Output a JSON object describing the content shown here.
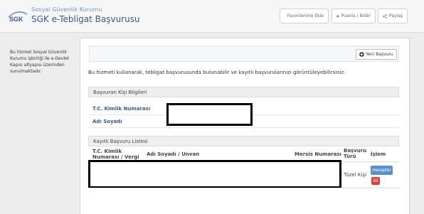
{
  "header": {
    "institution": "Sosyal Güvenlik Kurumu",
    "app_title": "SGK e-Tebligat Başvurusu",
    "logo_text": "SGK",
    "buttons": {
      "favorites": "Favorilerime Ekle",
      "rate": "Puanla / Bildir",
      "share": "Paylaş"
    }
  },
  "sidebar": {
    "note": "Bu hizmet Sosyal Güvenlik Kurumu işbirliği ile e-Devlet Kapısı altyapısı üzerinden sunulmaktadır."
  },
  "main": {
    "new_application": "Yeni Başvuru",
    "intro": "Bu hizmeti kullanarak, tebligat başvurusunda bulunabilir ve kayıtlı başvurularınızı görüntüleyebilirsiniz.",
    "applicant": {
      "title": "Başvuran Kişi Bilgileri",
      "tc_label": "T.C. Kimlik Numarası",
      "name_label": "Adı Soyadı"
    },
    "list": {
      "title": "Kayıtlı Başvuru Listesi",
      "headers": {
        "tc": "T.C. Kimlik Numarası / Vergi Numarası",
        "name": "Adı Soyadı / Unvan",
        "mersis": "Mersis Numarası",
        "type": "Başvuru Türü",
        "action": "İşlem"
      },
      "rows": [
        {
          "type": "Tüzel Kişi",
          "detail": "Hesaplar",
          "delete": "Sil"
        }
      ]
    }
  },
  "colors": {
    "brand_blue": "#3b5a89",
    "detail_button": "#5b8fc8",
    "delete_button": "#d0453f"
  }
}
